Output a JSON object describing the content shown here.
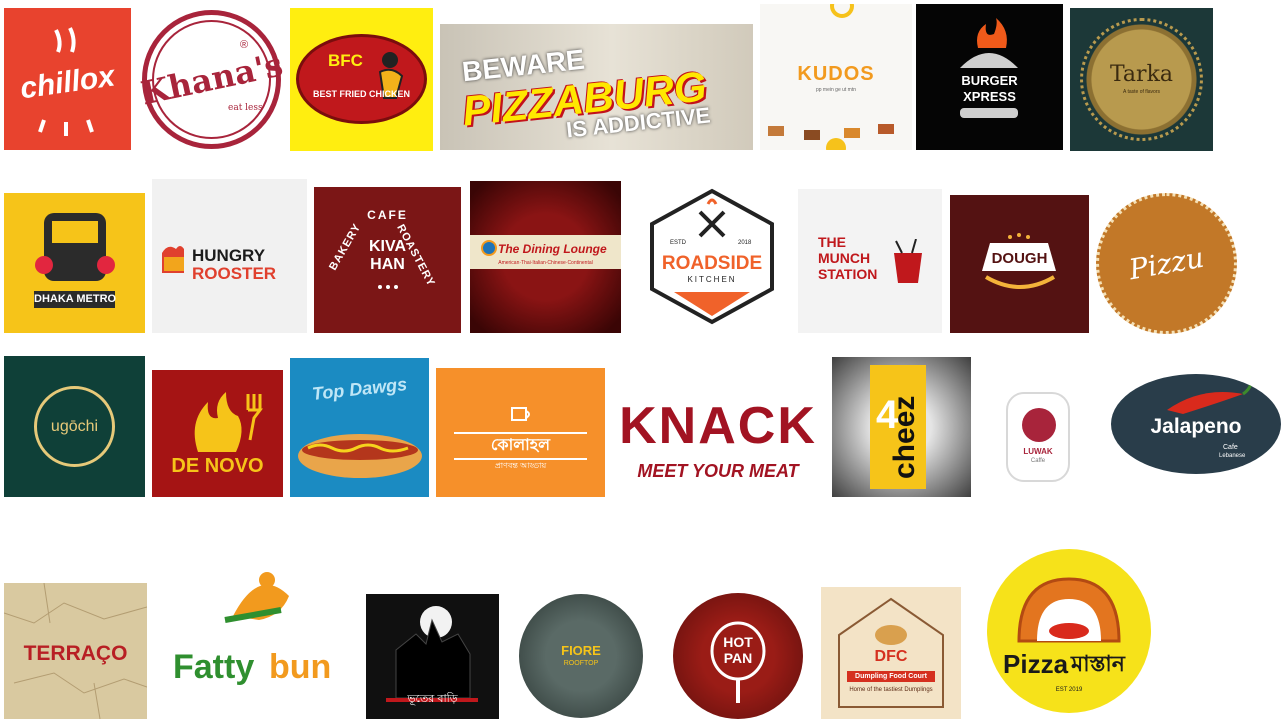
{
  "logos": {
    "chillox": {
      "name": "chillox",
      "color": "#e8432e"
    },
    "khanas": {
      "name": "Khana's",
      "tagline": "eat less",
      "reg": "®",
      "color": "#a8243b"
    },
    "bfc": {
      "abbr": "BFC",
      "name": "BEST FRIED CHICKEN",
      "color": "#c0181c"
    },
    "pizzaburg": {
      "line1": "BEWARE",
      "line2": "PIZZABURG",
      "line3": "IS ADDICTIVE"
    },
    "kudos": {
      "name": "KUDOS",
      "tagline": "pp mein ge ut mtn"
    },
    "burgerxpress": {
      "line1": "BURGER",
      "line2": "XPRESS"
    },
    "tarka": {
      "name": "Tarka",
      "tagline": "A taste of flavors"
    },
    "dhakametro": {
      "name": "DHAKA METRO"
    },
    "hungryrooster": {
      "line1": "HUNGRY",
      "line2": "ROOSTER"
    },
    "kivahan": {
      "top": "CAFE",
      "left": "BAKERY",
      "right": "ROASTERY",
      "name1": "KIVA",
      "name2": "HAN"
    },
    "dininglounge": {
      "name": "The Dining Lounge",
      "tagline": "American·Thai·Italian·Chinese·Continental"
    },
    "roadside": {
      "estd": "ESTD",
      "year": "2018",
      "name": "ROADSIDE",
      "sub": "KITCHEN"
    },
    "munchstation": {
      "line1": "THE",
      "line2": "MUNCH",
      "line3": "STATION"
    },
    "dough": {
      "name": "DOUGH"
    },
    "pizzau": {
      "name": "Pizzu"
    },
    "ugochi": {
      "name": "ugōchi"
    },
    "denovo": {
      "name": "DE NOVO"
    },
    "topdawgs": {
      "name": "Top Dawgs"
    },
    "kolahol": {
      "name": "কোলাহল",
      "tagline": "প্রাণবন্ত আড্ডায়"
    },
    "knack": {
      "name": "KNACK",
      "tagline": "MEET YOUR MEAT"
    },
    "cheez": {
      "num": "4",
      "name": "cheez"
    },
    "luwak": {
      "name": "LUWAK",
      "sub": "Caffe"
    },
    "jalapeno": {
      "name": "Jalapeno",
      "sub1": "Cafe",
      "sub2": "Lebanese"
    },
    "terraco": {
      "name": "TERRAÇO"
    },
    "fattybun": {
      "line1": "Fatty",
      "line2": "bun"
    },
    "bhoot": {
      "name": "ভূতের বাড়ি"
    },
    "fiore": {
      "name": "FIORE",
      "sub": "ROOFTOP"
    },
    "hotpan": {
      "line1": "HOT",
      "line2": "PAN"
    },
    "dfc": {
      "abbr": "DFC",
      "ribbon": "Dumpling Food Court",
      "tagline": "Home of the tastiest Dumplings"
    },
    "pizzamastan": {
      "name1": "Pizza",
      "name2": "মাস্তান",
      "est": "EST 2019"
    }
  }
}
